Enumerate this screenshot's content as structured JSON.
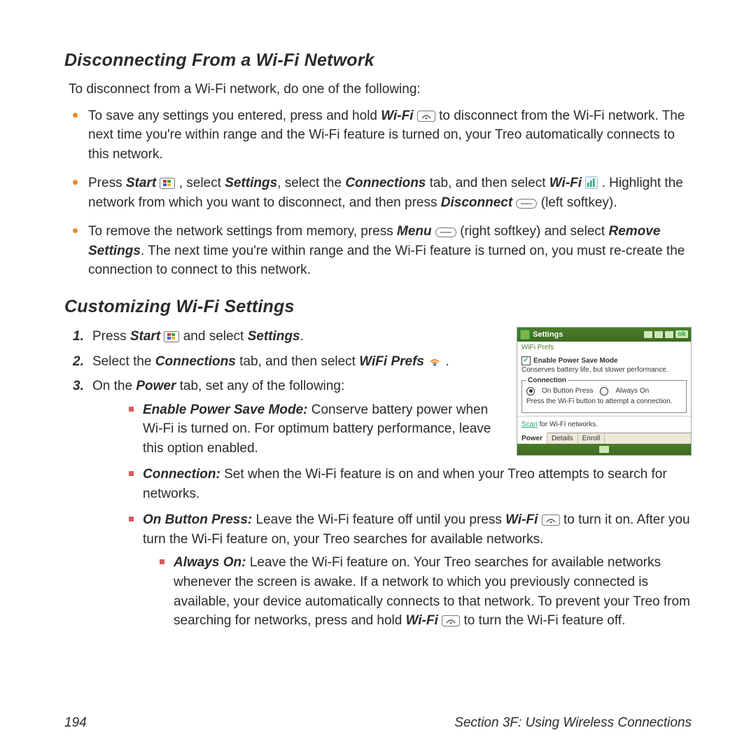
{
  "headings": {
    "h1": "Disconnecting From a Wi-Fi Network",
    "h2": "Customizing Wi-Fi Settings"
  },
  "intro": "To disconnect from a Wi-Fi network, do one of the following:",
  "bullets": {
    "b1_a": "To save any settings you entered, press and hold ",
    "b1_wifi": "Wi-Fi",
    "b1_b": " to disconnect from the Wi-Fi network. The next time you're within range and the Wi-Fi feature is turned on, your Treo automatically connects to this network.",
    "b2_a": "Press ",
    "b2_start": "Start",
    "b2_b": " , select ",
    "b2_settings": "Settings",
    "b2_c": ", select the ",
    "b2_conn": "Connections",
    "b2_d": " tab, and then select ",
    "b2_wifi": "Wi-Fi",
    "b2_e": " . Highlight the network from which you want to disconnect, and then press ",
    "b2_disc": "Disconnect",
    "b2_f": " (left softkey).",
    "b3_a": "To remove the network settings from memory, press ",
    "b3_menu": "Menu",
    "b3_b": " (right softkey) and select ",
    "b3_remset": "Remove Settings",
    "b3_c": ". The next time you're within range and the Wi-Fi feature is turned on, you must re-create the connection to connect to this network."
  },
  "steps": {
    "s1_a": "Press ",
    "s1_start": "Start",
    "s1_b": " and select ",
    "s1_settings": "Settings",
    "s1_c": ".",
    "s2_a": "Select the ",
    "s2_conn": "Connections",
    "s2_b": " tab, and then select ",
    "s2_wp": "WiFi Prefs",
    "s2_c": " .",
    "s3_a": "On the ",
    "s3_power": "Power",
    "s3_b": " tab, set any of the following:"
  },
  "sqs": {
    "q1_t": "Enable Power Save Mode:",
    "q1_b": " Conserve battery power when Wi-Fi is turned on. For optimum battery performance, leave this option enabled.",
    "q2_t": "Connection:",
    "q2_b": " Set when the Wi-Fi feature is on and when your Treo attempts to search for networks.",
    "q3_t": "On Button Press:",
    "q3_a": " Leave the Wi-Fi feature off until you press ",
    "q3_wifi": "Wi-Fi",
    "q3_b": " to turn it on. After you turn the Wi-Fi feature on, your Treo searches for available networks.",
    "q4_t": "Always On:",
    "q4_a": " Leave the Wi-Fi feature on. Your Treo searches for available networks whenever the screen is awake. If a network to which you previously connected is available, your device automatically connects to that network. To prevent your Treo from searching for networks, press and hold ",
    "q4_wifi": "Wi-Fi",
    "q4_b": " to turn the Wi-Fi feature off."
  },
  "footer": {
    "page": "194",
    "section": "Section 3F: Using Wireless Connections"
  },
  "shot": {
    "title": "Settings",
    "ok": "ok",
    "crumb": "WiFi Prefs",
    "chk_label": "Enable Power Save Mode",
    "chk_sub": "Conserves battery life, but slower performance.",
    "legend": "Connection",
    "rad1": "On Button Press",
    "rad2": "Always On",
    "conn_sub": "Press the Wi-Fi button to attempt a connection.",
    "scan_link": "Scan",
    "scan_rest": " for Wi-Fi networks.",
    "tab1": "Power",
    "tab2": "Details",
    "tab3": "Enroll"
  }
}
